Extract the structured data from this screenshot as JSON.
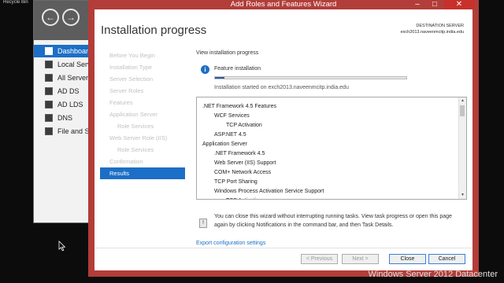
{
  "desktop": {
    "recycle_bin_label": "Recycle Bin",
    "watermark": "Windows Server 2012 Datacenter"
  },
  "server_manager": {
    "nav": [
      {
        "label": "Dashboard",
        "icon": "dashboard-icon"
      },
      {
        "label": "Local Server",
        "icon": "local-server-icon"
      },
      {
        "label": "All Servers",
        "icon": "all-servers-icon"
      },
      {
        "label": "AD DS",
        "icon": "ad-ds-icon"
      },
      {
        "label": "AD LDS",
        "icon": "ad-lds-icon"
      },
      {
        "label": "DNS",
        "icon": "dns-icon"
      },
      {
        "label": "File and Storage Services",
        "icon": "file-storage-icon"
      }
    ]
  },
  "wizard": {
    "title": "Add Roles and Features Wizard",
    "page_title": "Installation progress",
    "destination_label": "DESTINATION SERVER",
    "destination_server": "exch2013.naveenmcitp.india.edu",
    "steps": [
      {
        "label": "Before You Begin",
        "sub": false,
        "current": false
      },
      {
        "label": "Installation Type",
        "sub": false,
        "current": false
      },
      {
        "label": "Server Selection",
        "sub": false,
        "current": false
      },
      {
        "label": "Server Roles",
        "sub": false,
        "current": false
      },
      {
        "label": "Features",
        "sub": false,
        "current": false
      },
      {
        "label": "Application Server",
        "sub": false,
        "current": false
      },
      {
        "label": "Role Services",
        "sub": true,
        "current": false
      },
      {
        "label": "Web Server Role (IIS)",
        "sub": false,
        "current": false
      },
      {
        "label": "Role Services",
        "sub": true,
        "current": false
      },
      {
        "label": "Confirmation",
        "sub": false,
        "current": false
      },
      {
        "label": "Results",
        "sub": false,
        "current": true
      }
    ],
    "section_label": "View installation progress",
    "status": "Feature installation",
    "progress_fraction": 0.05,
    "started_text": "Installation started on exch2013.naveenmcitp.india.edu",
    "results": [
      {
        "text": ".NET Framework 4.5 Features",
        "level": 0
      },
      {
        "text": "WCF Services",
        "level": 1
      },
      {
        "text": "TCP Activation",
        "level": 2
      },
      {
        "text": "ASP.NET 4.5",
        "level": 1
      },
      {
        "text": "Application Server",
        "level": 0
      },
      {
        "text": ".NET Framework 4.5",
        "level": 1
      },
      {
        "text": "Web Server (IIS) Support",
        "level": 1
      },
      {
        "text": "COM+ Network Access",
        "level": 1
      },
      {
        "text": "TCP Port Sharing",
        "level": 1
      },
      {
        "text": "Windows Process Activation Service Support",
        "level": 1
      },
      {
        "text": "TCP Activation",
        "level": 2
      }
    ],
    "note": "You can close this wizard without interrupting running tasks. View task progress or open this page again by clicking Notifications in the command bar, and then Task Details.",
    "export_link": "Export configuration settings",
    "buttons": {
      "previous": "< Previous",
      "next": "Next >",
      "close": "Close",
      "cancel": "Cancel"
    }
  },
  "colors": {
    "wizard_frame": "#b23d39",
    "accent": "#1c6fc6"
  }
}
